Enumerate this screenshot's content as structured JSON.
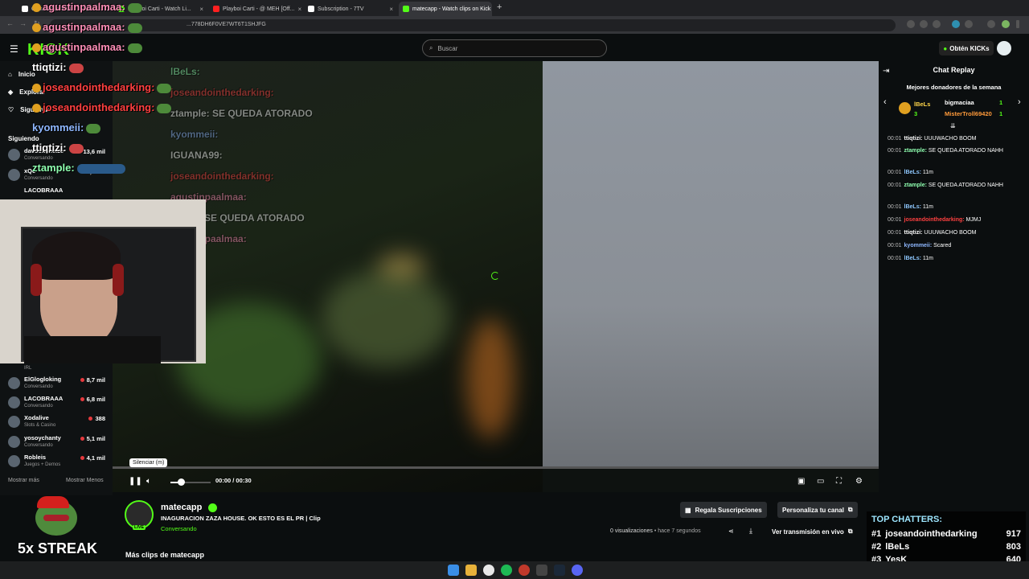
{
  "browser": {
    "tabs": [
      {
        "label": "Comunidad Kick - EXCLUSIVO"
      },
      {
        "label": "Playboi Carti - Watch Li..."
      },
      {
        "label": "Playboi Carti - @ MEH [Off..."
      },
      {
        "label": "Subscription - 7TV"
      },
      {
        "label": "matecapp - Watch clips on Kick"
      }
    ],
    "url": "...778DH6F0VE7WT6T1SHJFG"
  },
  "header": {
    "logo": "KICK",
    "search_placeholder": "Buscar",
    "kicks_button": "Obtén KICKs"
  },
  "sidebar": {
    "nav": [
      {
        "label": "Inicio"
      },
      {
        "label": "Explorar"
      },
      {
        "label": "Siguiendo"
      }
    ],
    "section_title": "Siguiendo",
    "channels_top": [
      {
        "name": "davooxeneize",
        "sub": "Conversando",
        "viewers": "13,6 mil"
      },
      {
        "name": "xQc",
        "sub": "Conversando",
        "viewers": "6,9 mil"
      },
      {
        "name": "LACOBRAAA",
        "sub": "",
        "viewers": ""
      }
    ],
    "channels_bottom": [
      {
        "name": "ElGlogloking",
        "sub": "Conversando",
        "viewers": "8,7 mil"
      },
      {
        "name": "LACOBRAAA",
        "sub": "Conversando",
        "viewers": "6,8 mil"
      },
      {
        "name": "Xodalive",
        "sub": "Slots & Casino",
        "viewers": "388"
      },
      {
        "name": "yosoychanty",
        "sub": "Conversando",
        "viewers": "5,1 mil"
      },
      {
        "name": "Robleis",
        "sub": "Juegos + Demos",
        "viewers": "4,1 mil"
      }
    ],
    "irl_label": "IRL",
    "show_more": "Mostrar más",
    "show_less": "Mostrar Menos"
  },
  "overlay_chat": [
    {
      "user": "agustinpaalmaa:",
      "color": "#ff8fb8"
    },
    {
      "user": "agustinpaalmaa:",
      "color": "#ff8fb8"
    },
    {
      "user": "agustinpaalmaa:",
      "color": "#ff8fb8"
    },
    {
      "user": "ttiqtizi:",
      "color": "#ffffff"
    },
    {
      "user": "joseandointhedarking:",
      "color": "#ff4040"
    },
    {
      "user": "joseandointhedarking:",
      "color": "#ff4040"
    },
    {
      "user": "kyommeii:",
      "color": "#8fb8ff"
    },
    {
      "user": "ttiqtizi:",
      "color": "#ffffff"
    },
    {
      "user": "ztample:",
      "color": "#8fffb0"
    }
  ],
  "stream_overlay": {
    "lines": [
      "lBeLs:",
      "joseandointhedarking:",
      "ztample: SE QUEDA ATORADO",
      "kyommeii:",
      "IGUANA99:",
      "joseandointhedarking:",
      "agustinpaalmaa:",
      "ample: SE QUEDA ATORADO",
      "agustinpaalmaa:"
    ]
  },
  "player": {
    "tooltip": "Silenciar (m)",
    "time": "00:00 / 00:30",
    "volume": 0.25
  },
  "chat": {
    "title": "Chat Replay",
    "donors_title": "Mejores donadores de la semana",
    "donors": [
      {
        "name": "lBeLs",
        "count": "3"
      },
      {
        "name": "bigmaciaa",
        "count": "1"
      },
      {
        "name": "MisterTroll69420",
        "count": "1"
      }
    ],
    "messages": [
      {
        "time": "00:01",
        "user": "ttiqtizi:",
        "color": "#ffffff",
        "text": "UUUWACHO BOOM"
      },
      {
        "time": "00:01",
        "user": "ztample:",
        "color": "#8fffb0",
        "text": "SE QUEDA ATORADO NAHH"
      },
      {
        "time": "00:01",
        "user": "lBeLs:",
        "color": "#8fc8ff",
        "text": "11m"
      },
      {
        "time": "00:01",
        "user": "ztample:",
        "color": "#8fffb0",
        "text": "SE QUEDA ATORADO NAHH"
      },
      {
        "time": "00:01",
        "user": "lBeLs:",
        "color": "#8fc8ff",
        "text": "11m"
      },
      {
        "time": "00:01",
        "user": "joseandointhedarking:",
        "color": "#ff4040",
        "text": "MJMJ"
      },
      {
        "time": "00:01",
        "user": "ttiqtizi:",
        "color": "#ffffff",
        "text": "UUUWACHO BOOM"
      },
      {
        "time": "00:01",
        "user": "kyommeii:",
        "color": "#8fb8ff",
        "text": "Scared"
      },
      {
        "time": "00:01",
        "user": "lBeLs:",
        "color": "#8fc8ff",
        "text": "11m"
      }
    ]
  },
  "clip": {
    "streamer": "matecapp",
    "title": "INAGURACION ZAZA HOUSE. OK ESTO ES EL PR | Clip",
    "category": "Conversando",
    "live_badge": "LIVE",
    "views": "0 visualizaciones",
    "ago": "hace 7 segundos",
    "gift_button": "Regala Suscripciones",
    "customize_button": "Personaliza tu canal",
    "watch_live_button": "Ver transmisión en vivo",
    "more_clips": "Más clips de matecapp"
  },
  "top_chatters": {
    "title": "TOP CHATTERS:",
    "rows": [
      {
        "rank": "#1",
        "name": "joseandointhedarking",
        "count": "917"
      },
      {
        "rank": "#2",
        "name": "lBeLs",
        "count": "803"
      },
      {
        "rank": "#3",
        "name": "YesK",
        "count": "640"
      }
    ]
  },
  "streak": {
    "label": "5x STREAK"
  },
  "colors": {
    "accent": "#53fc18"
  }
}
